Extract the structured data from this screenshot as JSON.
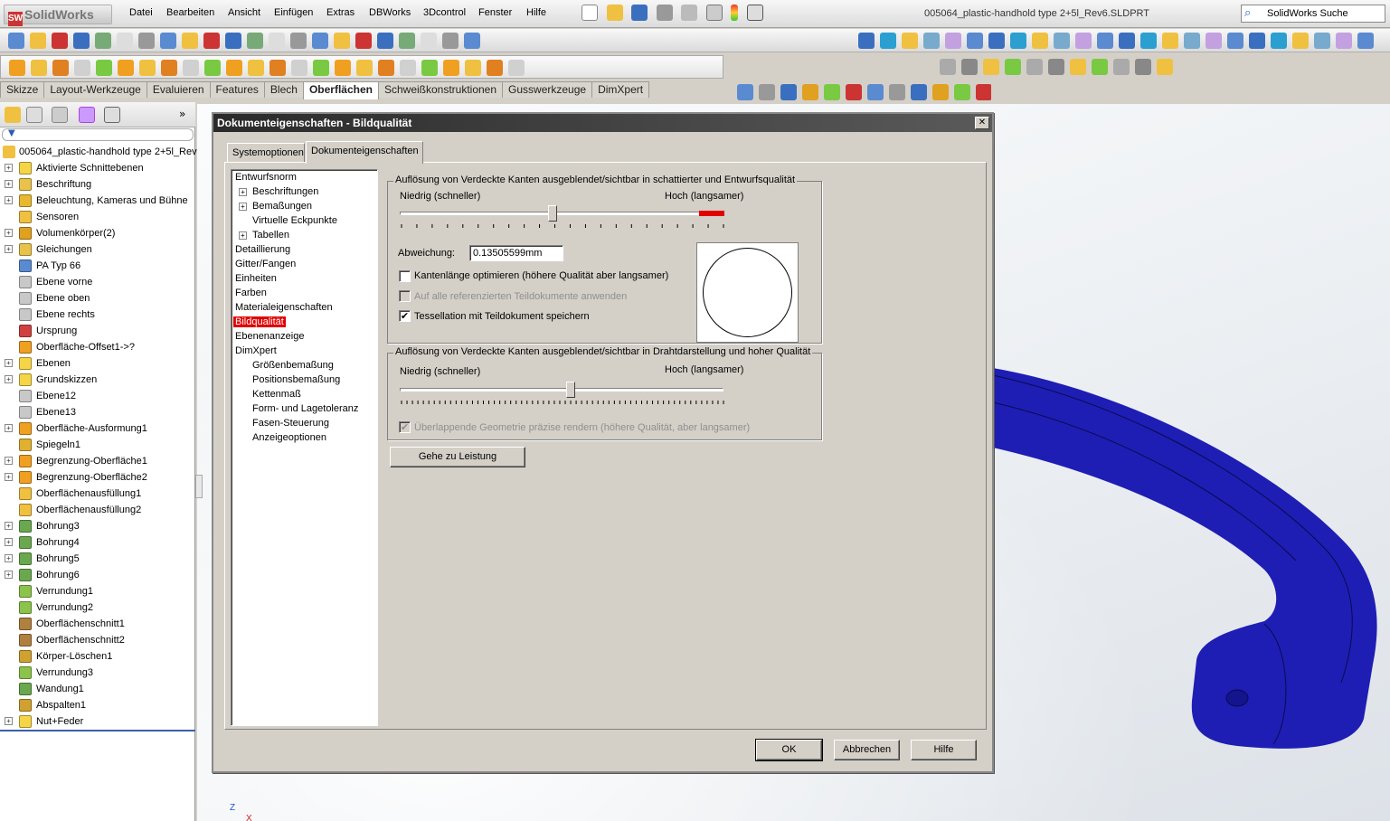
{
  "app": {
    "logo_text": "SolidWorks",
    "document_title": "005064_plastic-handhold type 2+5l_Rev6.SLDPRT",
    "search_placeholder": "SolidWorks Suche"
  },
  "menu": [
    "Datei",
    "Bearbeiten",
    "Ansicht",
    "Einfügen",
    "Extras",
    "DBWorks",
    "3Dcontrol",
    "Fenster",
    "Hilfe"
  ],
  "command_tabs": [
    "Skizze",
    "Layout-Werkzeuge",
    "Evaluieren",
    "Features",
    "Blech",
    "Oberflächen",
    "Schweißkonstruktionen",
    "Gusswerkzeuge",
    "DimXpert"
  ],
  "active_command_tab": "Oberflächen",
  "feature_tree": {
    "root": "005064_plastic-handhold type 2+5l_Rev",
    "items": [
      {
        "label": "Aktivierte Schnittebenen",
        "expand": true,
        "icon": "folder-icon",
        "color": "#f5d547"
      },
      {
        "label": "Beschriftung",
        "expand": true,
        "icon": "annotation-icon",
        "color": "#e8c24a"
      },
      {
        "label": "Beleuchtung, Kameras und Bühne",
        "expand": true,
        "icon": "lighting-icon",
        "color": "#e8b830"
      },
      {
        "label": "Sensoren",
        "expand": false,
        "icon": "sensor-icon",
        "color": "#f0c040"
      },
      {
        "label": "Volumenkörper(2)",
        "expand": true,
        "icon": "solid-bodies-icon",
        "color": "#e0a020"
      },
      {
        "label": "Gleichungen",
        "expand": true,
        "icon": "equation-icon",
        "color": "#e8c24a"
      },
      {
        "label": "PA Typ 66",
        "expand": false,
        "icon": "material-icon",
        "color": "#5a8ad0"
      },
      {
        "label": "Ebene vorne",
        "expand": false,
        "icon": "plane-icon",
        "color": "#c8c8c8"
      },
      {
        "label": "Ebene oben",
        "expand": false,
        "icon": "plane-icon",
        "color": "#c8c8c8"
      },
      {
        "label": "Ebene rechts",
        "expand": false,
        "icon": "plane-icon",
        "color": "#c8c8c8"
      },
      {
        "label": "Ursprung",
        "expand": false,
        "icon": "origin-icon",
        "color": "#d04040"
      },
      {
        "label": "Oberfläche-Offset1->?",
        "expand": false,
        "icon": "surface-offset-icon",
        "color": "#f0a020"
      },
      {
        "label": "Ebenen",
        "expand": true,
        "icon": "folder-icon",
        "color": "#f5d547"
      },
      {
        "label": "Grundskizzen",
        "expand": true,
        "icon": "folder-icon",
        "color": "#f5d547"
      },
      {
        "label": "Ebene12",
        "expand": false,
        "icon": "plane-icon",
        "color": "#c8c8c8"
      },
      {
        "label": "Ebene13",
        "expand": false,
        "icon": "plane-icon",
        "color": "#c8c8c8"
      },
      {
        "label": "Oberfläche-Ausformung1",
        "expand": true,
        "icon": "surface-loft-icon",
        "color": "#f0a020"
      },
      {
        "label": "Spiegeln1",
        "expand": false,
        "icon": "mirror-icon",
        "color": "#e0b030"
      },
      {
        "label": "Begrenzung-Oberfläche1",
        "expand": true,
        "icon": "boundary-surface-icon",
        "color": "#f0a020"
      },
      {
        "label": "Begrenzung-Oberfläche2",
        "expand": true,
        "icon": "boundary-surface-icon",
        "color": "#f0a020"
      },
      {
        "label": "Oberflächenausfüllung1",
        "expand": false,
        "icon": "fill-surface-icon",
        "color": "#f0c040"
      },
      {
        "label": "Oberflächenausfüllung2",
        "expand": false,
        "icon": "fill-surface-icon",
        "color": "#f0c040"
      },
      {
        "label": "Bohrung3",
        "expand": true,
        "icon": "hole-icon",
        "color": "#6aa84f"
      },
      {
        "label": "Bohrung4",
        "expand": true,
        "icon": "hole-icon",
        "color": "#6aa84f"
      },
      {
        "label": "Bohrung5",
        "expand": true,
        "icon": "hole-icon",
        "color": "#6aa84f"
      },
      {
        "label": "Bohrung6",
        "expand": true,
        "icon": "hole-icon",
        "color": "#6aa84f"
      },
      {
        "label": "Verrundung1",
        "expand": false,
        "icon": "fillet-icon",
        "color": "#8cc34a"
      },
      {
        "label": "Verrundung2",
        "expand": false,
        "icon": "fillet-icon",
        "color": "#8cc34a"
      },
      {
        "label": "Oberflächenschnitt1",
        "expand": false,
        "icon": "surface-cut-icon",
        "color": "#b08040"
      },
      {
        "label": "Oberflächenschnitt2",
        "expand": false,
        "icon": "surface-cut-icon",
        "color": "#b08040"
      },
      {
        "label": "Körper-Löschen1",
        "expand": false,
        "icon": "delete-body-icon",
        "color": "#d0a030"
      },
      {
        "label": "Verrundung3",
        "expand": false,
        "icon": "fillet-icon",
        "color": "#8cc34a"
      },
      {
        "label": "Wandung1",
        "expand": false,
        "icon": "shell-icon",
        "color": "#6aa84f"
      },
      {
        "label": "Abspalten1",
        "expand": false,
        "icon": "split-icon",
        "color": "#d0a030"
      },
      {
        "label": "Nut+Feder",
        "expand": true,
        "icon": "folder-icon",
        "color": "#f5d547"
      }
    ]
  },
  "dialog": {
    "title": "Dokumenteigenschaften - Bildqualität",
    "tabs": [
      "Systemoptionen",
      "Dokumenteigenschaften"
    ],
    "active_tab": "Dokumenteigenschaften",
    "nav": [
      {
        "label": "Entwurfsnorm",
        "level": 0,
        "expand": false
      },
      {
        "label": "Beschriftungen",
        "level": 1,
        "expand": true
      },
      {
        "label": "Bemaßungen",
        "level": 1,
        "expand": true
      },
      {
        "label": "Virtuelle Eckpunkte",
        "level": 1,
        "expand": false
      },
      {
        "label": "Tabellen",
        "level": 1,
        "expand": true
      },
      {
        "label": "Detaillierung",
        "level": 0,
        "expand": false
      },
      {
        "label": "Gitter/Fangen",
        "level": 0,
        "expand": false
      },
      {
        "label": "Einheiten",
        "level": 0,
        "expand": false
      },
      {
        "label": "Farben",
        "level": 0,
        "expand": false
      },
      {
        "label": "Materialeigenschaften",
        "level": 0,
        "expand": false
      },
      {
        "label": "Bildqualität",
        "level": 0,
        "expand": false
      },
      {
        "label": "Ebenenanzeige",
        "level": 0,
        "expand": false
      },
      {
        "label": "DimXpert",
        "level": 0,
        "expand": false
      },
      {
        "label": "Größenbemaßung",
        "level": 1,
        "expand": false
      },
      {
        "label": "Positionsbemaßung",
        "level": 1,
        "expand": false
      },
      {
        "label": "Kettenmaß",
        "level": 1,
        "expand": false
      },
      {
        "label": "Form- und Lagetoleranz",
        "level": 1,
        "expand": false
      },
      {
        "label": "Fasen-Steuerung",
        "level": 1,
        "expand": false
      },
      {
        "label": "Anzeigeoptionen",
        "level": 1,
        "expand": false
      }
    ],
    "selected_nav": "Bildqualität",
    "shaded_group": {
      "title": "Auflösung von Verdeckte Kanten ausgeblendet/sichtbar in schattierter und Entwurfsqualität",
      "low_label": "Niedrig (schneller)",
      "high_label": "Hoch (langsamer)",
      "slider_value": 0.47,
      "deviation_label": "Abweichung:",
      "deviation_value": "0.13505599mm",
      "opt_edge_label": "Kantenlänge optimieren (höhere Qualität aber langsamer)",
      "opt_edge_checked": false,
      "apply_refs_label": "Auf alle referenzierten Teildokumente anwenden",
      "apply_refs_checked": false,
      "save_tess_label": "Tessellation mit Teildokument speichern",
      "save_tess_checked": true,
      "check_mark": "✔"
    },
    "wire_group": {
      "title": "Auflösung von Verdeckte Kanten ausgeblendet/sichtbar in Drahtdarstellung und hoher Qualität",
      "low_label": "Niedrig (schneller)",
      "high_label": "Hoch (langsamer)",
      "slider_value": 0.53,
      "overlap_label": "Überlappende Geometrie präzise rendern (höhere Qualität, aber langsamer)",
      "overlap_checked": true
    },
    "goto_performance": "Gehe zu Leistung",
    "ok": "OK",
    "cancel": "Abbrechen",
    "help": "Hilfe",
    "close": "✕"
  },
  "triad": {
    "z": "Z",
    "x": "X"
  },
  "colors": {
    "model": "#1e1eb4",
    "selection": "#e00000",
    "slider_high_zone": "#e00000"
  }
}
